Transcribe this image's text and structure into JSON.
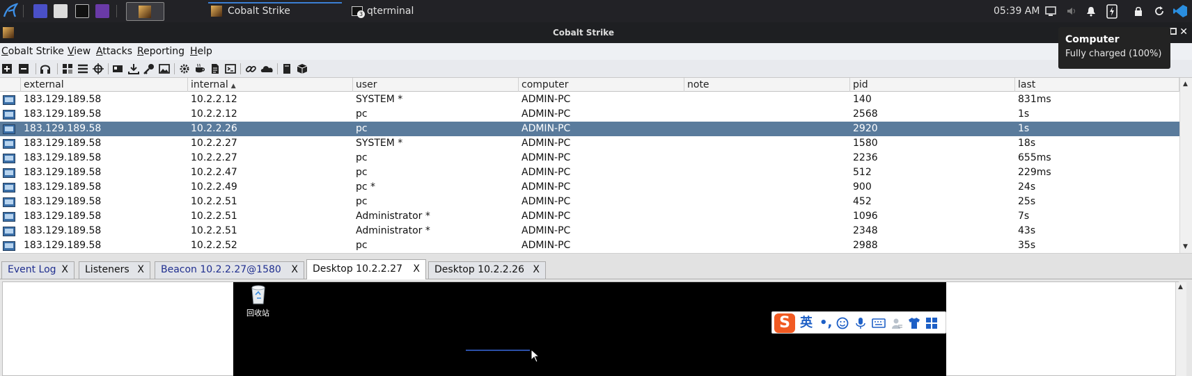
{
  "taskbar": {
    "windows": [
      {
        "label": "Cobalt Strike"
      },
      {
        "label": "qterminal",
        "badge": "3"
      }
    ],
    "clock": "05:39 AM"
  },
  "notification": {
    "title": "Computer",
    "body": "Fully charged (100%)"
  },
  "window": {
    "title": "Cobalt Strike"
  },
  "menu": [
    {
      "label": "Cobalt Strike",
      "mnemonic": "C",
      "rest": "obalt Strike"
    },
    {
      "label": "View",
      "mnemonic": "V",
      "rest": "iew"
    },
    {
      "label": "Attacks",
      "mnemonic": "A",
      "rest": "ttacks"
    },
    {
      "label": "Reporting",
      "mnemonic": "R",
      "rest": "eporting"
    },
    {
      "label": "Help",
      "mnemonic": "H",
      "rest": "elp"
    }
  ],
  "toolbar_icons": [
    "new-connection-icon",
    "disconnect-icon",
    "headset-icon",
    "pivot-graph-icon",
    "session-table-icon",
    "target-icon",
    "credentials-icon",
    "download-icon",
    "key-icon",
    "screenshot-icon",
    "settings-icon",
    "coffee-icon",
    "document-icon",
    "console-icon",
    "link-icon",
    "cloud-icon",
    "book-icon",
    "package-icon"
  ],
  "table": {
    "columns": [
      "external",
      "internal",
      "user",
      "computer",
      "note",
      "pid",
      "last"
    ],
    "sorted_column": "internal",
    "selected_row": 2,
    "rows": [
      {
        "external": "183.129.189.58",
        "internal": "10.2.2.12",
        "user": "SYSTEM *",
        "computer": "ADMIN-PC",
        "note": "",
        "pid": "140",
        "last": "831ms"
      },
      {
        "external": "183.129.189.58",
        "internal": "10.2.2.12",
        "user": "pc",
        "computer": "ADMIN-PC",
        "note": "",
        "pid": "2568",
        "last": "1s"
      },
      {
        "external": "183.129.189.58",
        "internal": "10.2.2.26",
        "user": "pc",
        "computer": "ADMIN-PC",
        "note": "",
        "pid": "2920",
        "last": "1s"
      },
      {
        "external": "183.129.189.58",
        "internal": "10.2.2.27",
        "user": "SYSTEM *",
        "computer": "ADMIN-PC",
        "note": "",
        "pid": "1580",
        "last": "18s"
      },
      {
        "external": "183.129.189.58",
        "internal": "10.2.2.27",
        "user": "pc",
        "computer": "ADMIN-PC",
        "note": "",
        "pid": "2236",
        "last": "655ms"
      },
      {
        "external": "183.129.189.58",
        "internal": "10.2.2.47",
        "user": "pc",
        "computer": "ADMIN-PC",
        "note": "",
        "pid": "512",
        "last": "229ms"
      },
      {
        "external": "183.129.189.58",
        "internal": "10.2.2.49",
        "user": "pc *",
        "computer": "ADMIN-PC",
        "note": "",
        "pid": "900",
        "last": "24s"
      },
      {
        "external": "183.129.189.58",
        "internal": "10.2.2.51",
        "user": "pc",
        "computer": "ADMIN-PC",
        "note": "",
        "pid": "452",
        "last": "25s"
      },
      {
        "external": "183.129.189.58",
        "internal": "10.2.2.51",
        "user": "Administrator *",
        "computer": "ADMIN-PC",
        "note": "",
        "pid": "1096",
        "last": "7s"
      },
      {
        "external": "183.129.189.58",
        "internal": "10.2.2.51",
        "user": "Administrator *",
        "computer": "ADMIN-PC",
        "note": "",
        "pid": "2348",
        "last": "43s"
      },
      {
        "external": "183.129.189.58",
        "internal": "10.2.2.52",
        "user": "pc",
        "computer": "ADMIN-PC",
        "note": "",
        "pid": "2988",
        "last": "35s"
      }
    ]
  },
  "tabs": [
    {
      "label": "Event Log",
      "close": "X"
    },
    {
      "label": "Listeners",
      "close": "X"
    },
    {
      "label": "Beacon 10.2.2.27@1580",
      "close": "X"
    },
    {
      "label": "Desktop 10.2.2.27",
      "close": "X",
      "active": true
    },
    {
      "label": "Desktop 10.2.2.26",
      "close": "X"
    }
  ],
  "desktop": {
    "recycle_bin_label": "回收站",
    "ime": {
      "logo": "S",
      "mode": "英",
      "punct": "•,"
    }
  },
  "colors": {
    "selection": "#5a7b9c",
    "tab_link": "#1f2e8f",
    "ime_brand": "#f15a22"
  }
}
